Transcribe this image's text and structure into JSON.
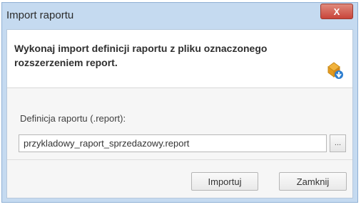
{
  "dialog": {
    "title": "Import raportu",
    "close_label": "X",
    "header_text": "Wykonaj import definicji raportu z pliku oznaczonego rozszerzeniem report.",
    "header_icon": "import-report-icon"
  },
  "form": {
    "field_label": "Definicja raportu (.report):",
    "file_path": "przykladowy_raport_sprzedazowy.report",
    "browse_label": "..."
  },
  "footer": {
    "import_label": "Importuj",
    "close_label": "Zamknij"
  },
  "colors": {
    "title_bar": "#c5daf0",
    "close_button": "#c9443a"
  }
}
